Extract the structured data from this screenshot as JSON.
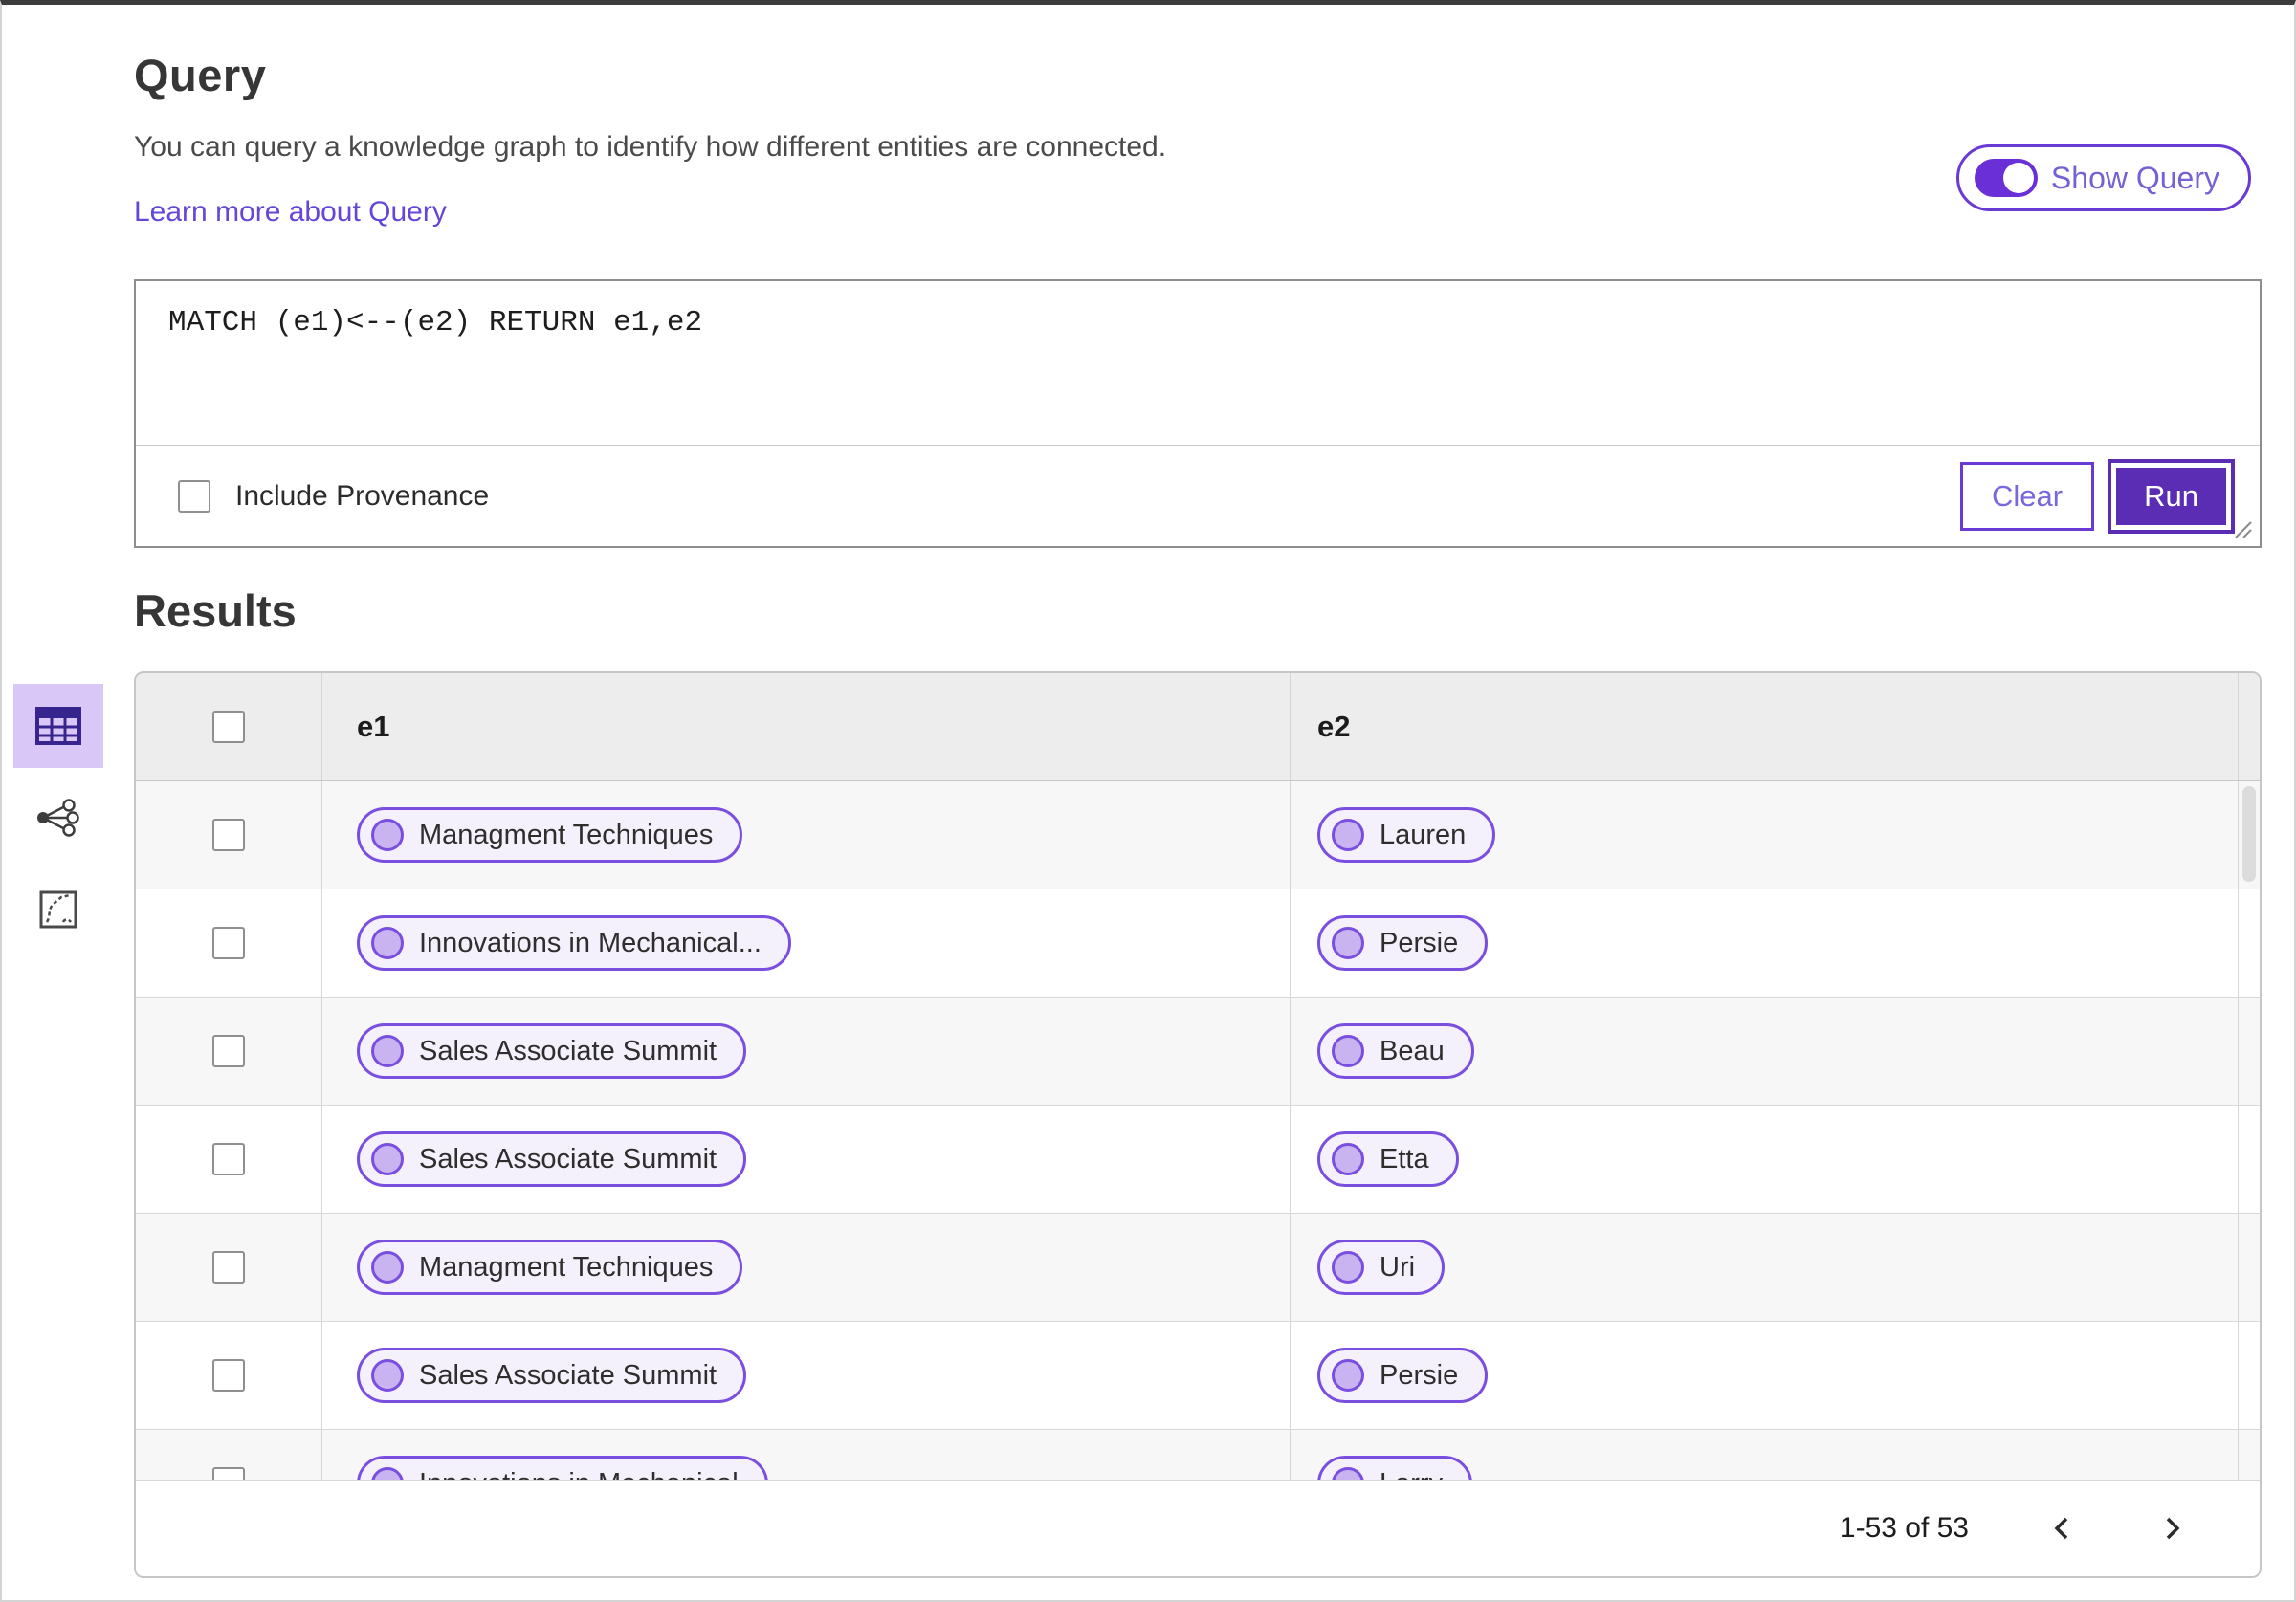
{
  "query_section": {
    "title": "Query",
    "description": "You can query a knowledge graph to identify how different entities are connected.",
    "learn_more_link": "Learn more about Query",
    "show_query_toggle": {
      "label": "Show Query",
      "state": "on"
    },
    "query_input": {
      "value": "MATCH (e1)<--(e2) RETURN e1,e2"
    },
    "include_provenance": {
      "label": "Include Provenance",
      "checked": false
    },
    "clear_button": "Clear",
    "run_button": "Run"
  },
  "results_section": {
    "title": "Results",
    "view_switcher": [
      {
        "icon": "table-view-icon",
        "selected": true
      },
      {
        "icon": "graph-view-icon",
        "selected": false
      },
      {
        "icon": "map-view-icon",
        "selected": false
      }
    ]
  },
  "table": {
    "columns": [
      "e1",
      "e2"
    ],
    "rows": [
      {
        "e1": "Managment Techniques",
        "e2": "Lauren"
      },
      {
        "e1": "Innovations in Mechanical...",
        "e2": "Persie"
      },
      {
        "e1": "Sales Associate Summit",
        "e2": "Beau"
      },
      {
        "e1": "Sales Associate Summit",
        "e2": "Etta"
      },
      {
        "e1": "Managment Techniques",
        "e2": "Uri"
      },
      {
        "e1": "Sales Associate Summit",
        "e2": "Persie"
      },
      {
        "e1": "Innovations in Mechanical",
        "e2": "Larry"
      }
    ],
    "pagination": {
      "range_label": "1-53 of 53"
    }
  },
  "colors": {
    "accent_purple": "#6a3ad4",
    "run_button_bg": "#5b2db4",
    "pill_border": "#7a4fe0",
    "pill_bg": "#f4f0fc",
    "pill_circle": "#c9b3f0",
    "selected_view_bg": "#d9c8f7",
    "table_header_bg": "#ededed",
    "row_alt_bg": "#f7f7f7",
    "link_purple": "#6546d8"
  }
}
